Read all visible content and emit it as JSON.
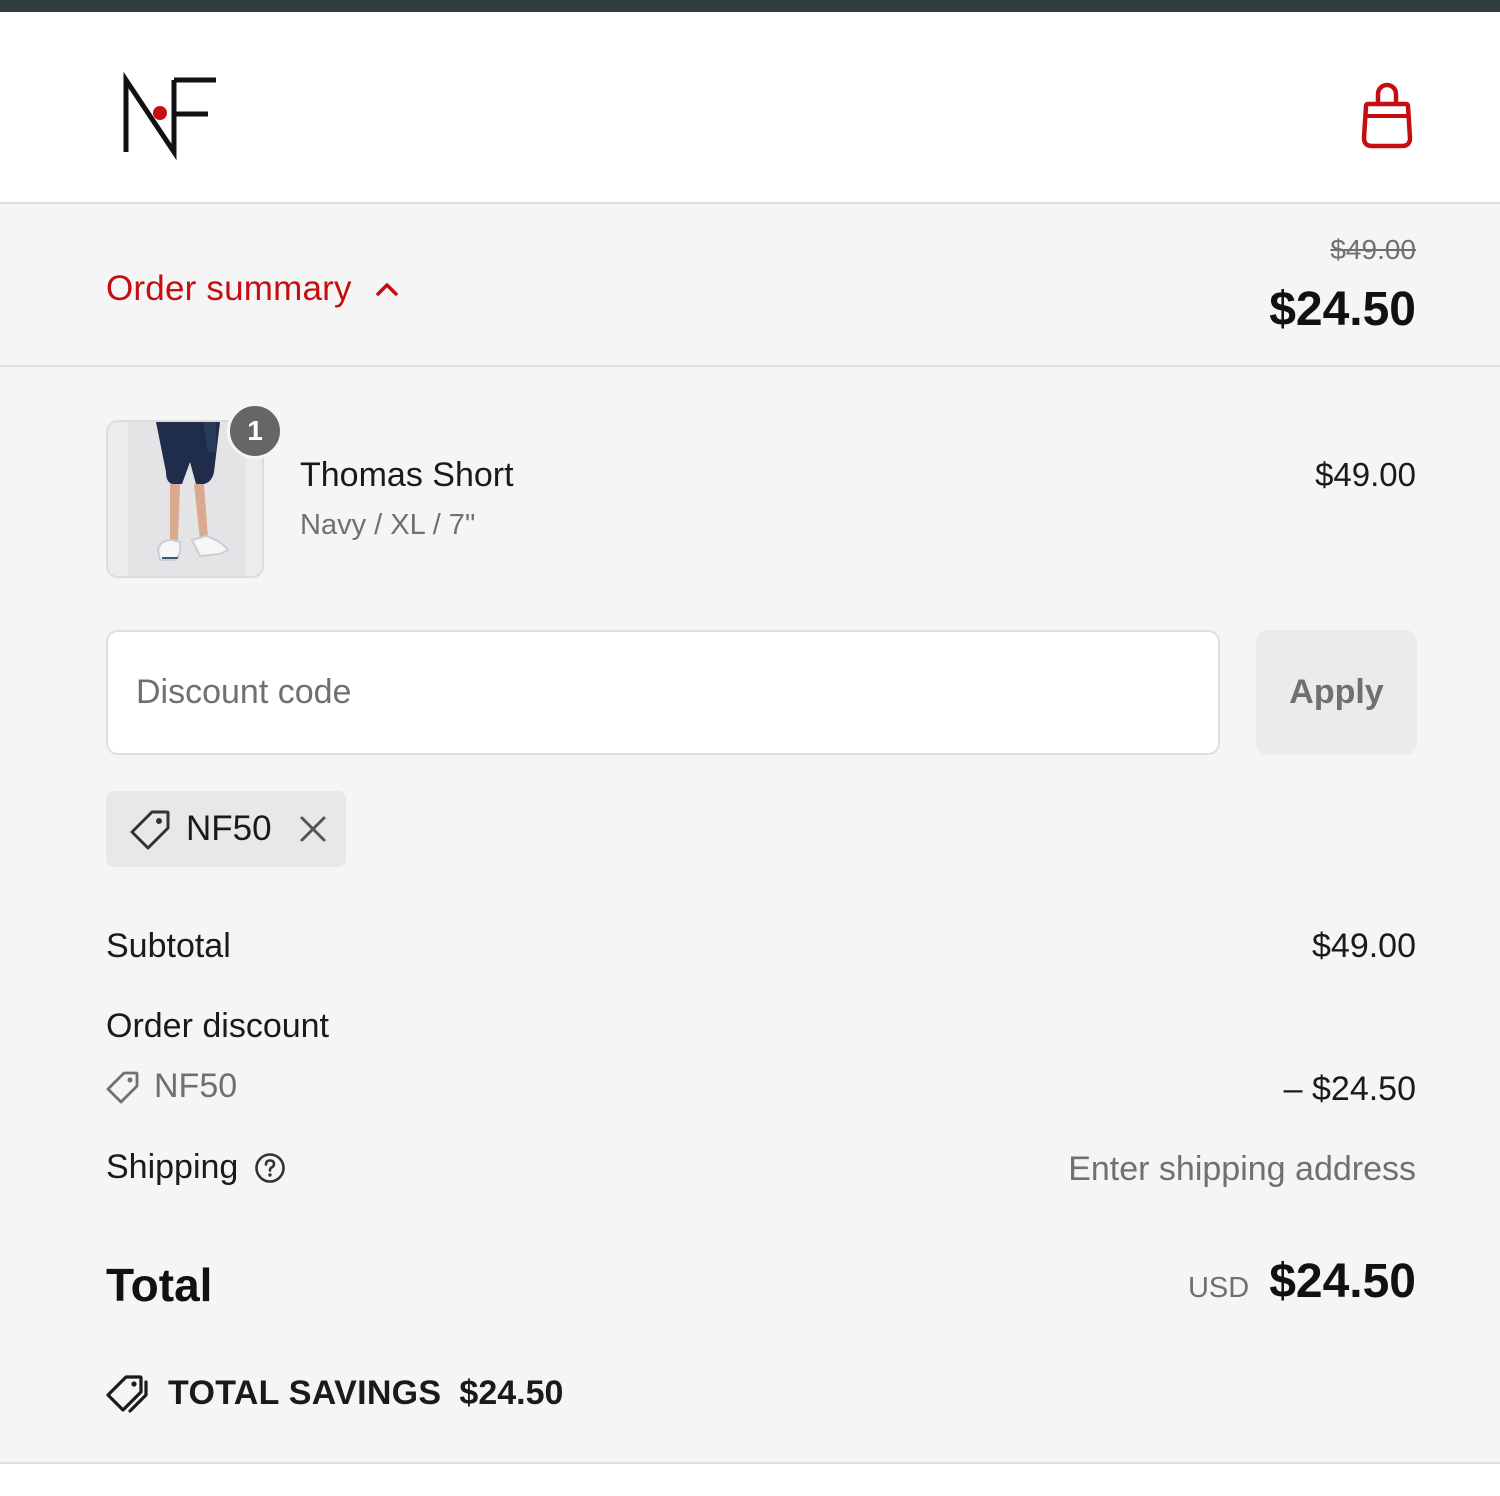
{
  "brand": {
    "logo_alt": "NF",
    "accent_color": "#c60e12"
  },
  "header": {
    "cart_icon": "shopping-bag-icon"
  },
  "summary_toggle": {
    "label": "Order summary",
    "chevron_icon": "chevron-up-icon",
    "compare_at_price": "$49.00",
    "total": "$24.50"
  },
  "line_items": [
    {
      "quantity": "1",
      "name": "Thomas Short",
      "variant": "Navy / XL / 7\"",
      "price": "$49.00"
    }
  ],
  "discount": {
    "placeholder": "Discount code",
    "value": "",
    "apply_label": "Apply",
    "applied_code": "NF50",
    "tag_icon": "tag-icon",
    "remove_icon": "close-icon"
  },
  "totals": {
    "subtotal_label": "Subtotal",
    "subtotal_value": "$49.00",
    "order_discount_label": "Order discount",
    "order_discount_code": "NF50",
    "order_discount_value": "– $24.50",
    "shipping_label": "Shipping",
    "shipping_help_icon": "help-circle-icon",
    "shipping_value": "Enter shipping address",
    "total_label": "Total",
    "total_currency": "USD",
    "total_value": "$24.50",
    "savings_label": "TOTAL SAVINGS",
    "savings_value": "$24.50"
  }
}
